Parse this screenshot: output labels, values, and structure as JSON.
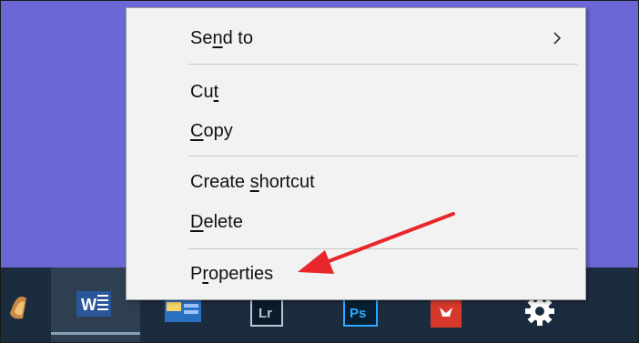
{
  "colors": {
    "desktop": "#6b68d6",
    "taskbar": "#1c2c3f",
    "menu_bg": "#f2f2f2",
    "arrow": "#e8262b"
  },
  "menu": {
    "send_to": {
      "pre": "Se",
      "key": "n",
      "post": "d to"
    },
    "cut": {
      "pre": "Cu",
      "key": "t",
      "post": ""
    },
    "copy": {
      "pre": "",
      "key": "C",
      "post": "opy"
    },
    "create_shortcut": {
      "pre": "Create ",
      "key": "s",
      "post": "hortcut"
    },
    "delete": {
      "pre": "",
      "key": "D",
      "post": "elete"
    },
    "properties": {
      "pre": "P",
      "key": "r",
      "post": "operties"
    }
  },
  "taskbar": {
    "icons": [
      {
        "name": "app-icon-partial"
      },
      {
        "name": "word-icon",
        "text": "W"
      },
      {
        "name": "outlook-icon"
      },
      {
        "name": "lightroom-icon",
        "text": "Lr"
      },
      {
        "name": "photoshop-icon",
        "text": "Ps"
      },
      {
        "name": "red-app-icon"
      },
      {
        "name": "settings-gear-icon"
      }
    ]
  }
}
